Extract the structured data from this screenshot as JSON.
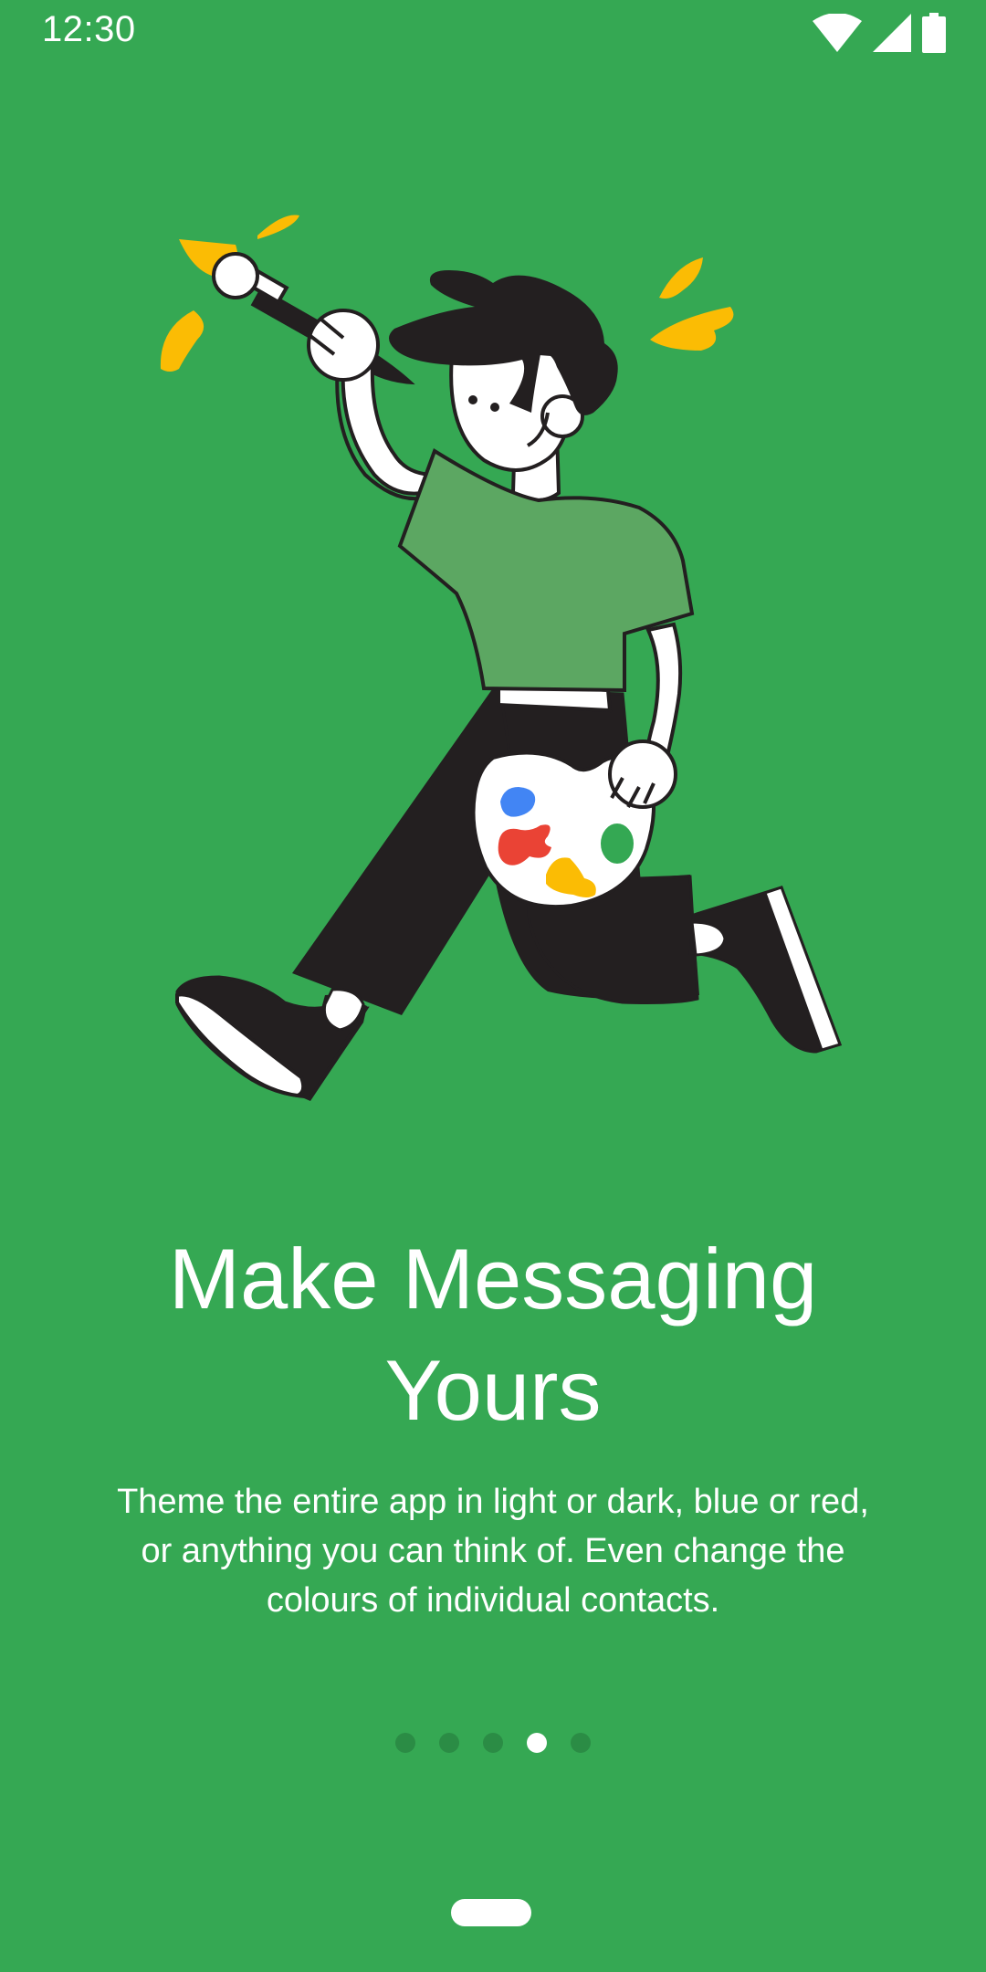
{
  "status_bar": {
    "time": "12:30",
    "icons": [
      "wifi-icon",
      "cell-signal-icon",
      "battery-icon"
    ]
  },
  "onboarding": {
    "illustration": "painter-with-palette",
    "title_lines": [
      "Make Messaging",
      "Yours"
    ],
    "description_lines": [
      "Theme the entire app in light or dark, blue or red,",
      "or anything you can think of. Even change the",
      "colours of individual contacts."
    ],
    "page_count": 5,
    "current_page": 4
  },
  "colors": {
    "background": "#35a853",
    "dot_inactive": "#2b8c45",
    "dot_active": "#ffffff",
    "accent_yellow": "#fbbc04",
    "shirt_green": "#5ca762",
    "palette_blue": "#4285f4",
    "palette_red": "#ea4335",
    "palette_green": "#34a853"
  }
}
